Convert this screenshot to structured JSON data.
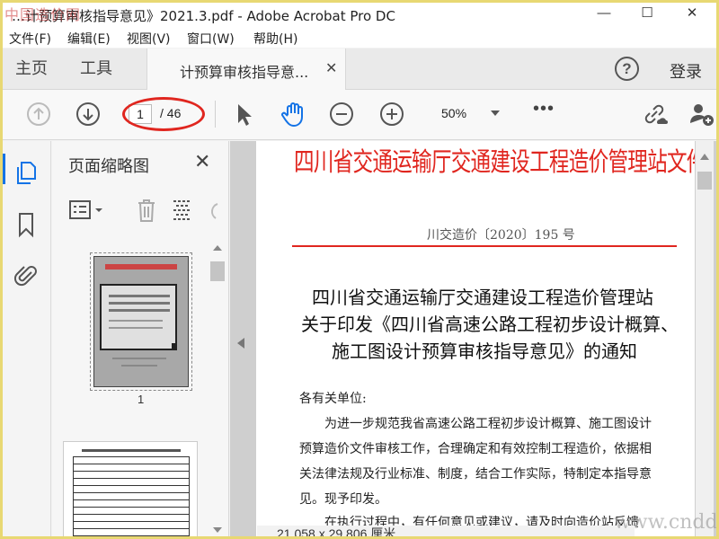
{
  "window": {
    "title": "…计预算审核指导意见》2021.3.pdf - Adobe Acrobat Pro DC",
    "watermark_top": "中国造价网",
    "minimize": "—",
    "maximize": "☐",
    "close": "✕"
  },
  "menu": [
    "文件(F)",
    "编辑(E)",
    "视图(V)",
    "窗口(W)",
    "帮助(H)"
  ],
  "tabs": {
    "home": "主页",
    "tools": "工具",
    "document": "计预算审核指导意...",
    "help": "?",
    "login": "登录"
  },
  "toolbar": {
    "current_page": "1",
    "total_pages": "/ 46",
    "zoom": "50%",
    "more": "•••"
  },
  "thumbnails": {
    "title": "页面缩略图",
    "close": "✕",
    "page_label": "1"
  },
  "document": {
    "header": "四川省交通运输厅交通建设工程造价管理站文件",
    "doc_number": "川交造价〔2020〕195 号",
    "title_lines": [
      "四川省交通运输厅交通建设工程造价管理站",
      "关于印发《四川省高速公路工程初步设计概算、",
      "施工图设计预算审核指导意见》的通知"
    ],
    "body_lines": [
      "各有关单位:",
      "　　为进一步规范我省高速公路工程初步设计概算、施工图设计",
      "预算造价文件审核工作，合理确定和有效控制工程造价，依据相",
      "关法律法规及行业标准、制度，结合工作实际，特制定本指导意",
      "见。现予印发。",
      "　　在执行过程中，有任何意见或建议，请及时向造价站反馈"
    ]
  },
  "status": {
    "page_size": "21.058 x 29.806 厘米"
  },
  "watermark_bottom": "www.cnddo.com",
  "colors": {
    "accent_blue": "#1473e6",
    "annotation_red": "#e0261f",
    "border_yellow": "#e8d873"
  }
}
